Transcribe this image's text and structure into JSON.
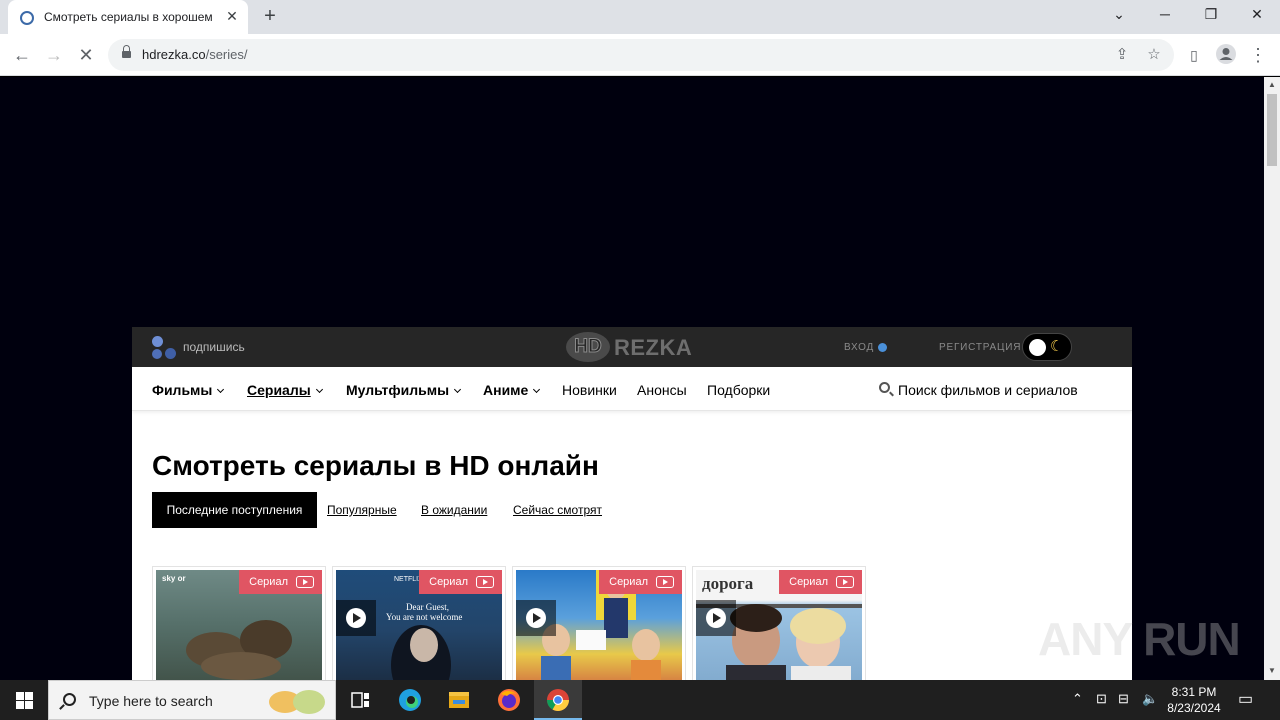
{
  "browser": {
    "tab_title": "Смотреть сериалы в хорошем",
    "tab_close": "✕",
    "new_tab": "+",
    "url_host": "hdrezka.co",
    "url_path": "/series/"
  },
  "site": {
    "subscribe": "подпишись",
    "logo_hd": "HD",
    "logo_rezka": "REZKA",
    "login": "ВХОД",
    "register": "РЕГИСТРАЦИЯ",
    "nav": [
      {
        "label": "Фильмы"
      },
      {
        "label": "Сериалы"
      },
      {
        "label": "Мультфильмы"
      },
      {
        "label": "Аниме"
      },
      {
        "label": "Новинки"
      },
      {
        "label": "Анонсы"
      },
      {
        "label": "Подборки"
      }
    ],
    "search_placeholder": "Поиск фильмов и сериалов",
    "page_title": "Смотреть сериалы в HD онлайн",
    "filters": [
      "Последние поступления",
      "Популярные",
      "В ожидании",
      "Сейчас смотрят"
    ],
    "cards": [
      {
        "badge": "Сериал",
        "poster_text": "sky or"
      },
      {
        "badge": "Сериал",
        "poster_text": "NETFLIX"
      },
      {
        "badge": "Сериал",
        "poster_text": ""
      },
      {
        "badge": "Сериал",
        "poster_text": "дорога"
      }
    ],
    "poster2_caption_1": "Dear Guest,",
    "poster2_caption_2": "You are not welcome"
  },
  "watermark": "ANY RUN",
  "taskbar": {
    "search_placeholder": "Type here to search",
    "time": "8:31 PM",
    "date": "8/23/2024"
  }
}
